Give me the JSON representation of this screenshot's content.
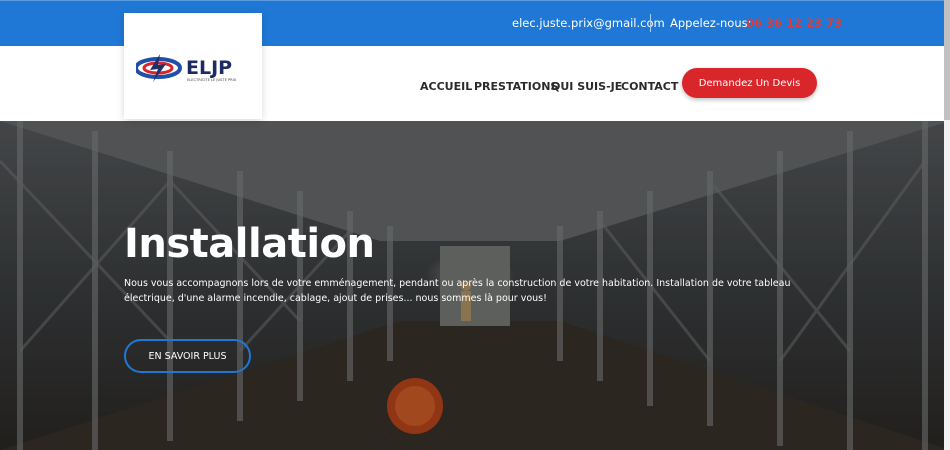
{
  "topbar": {
    "email": "elec.juste.prix@gmail.com",
    "call_label": "Appelez-nous:",
    "phone": "06 36 12 23 73"
  },
  "logo": {
    "text": "ELJP",
    "tagline": "ELECTRICITE LE JUSTE PRIX"
  },
  "nav": {
    "items": [
      "ACCUEIL",
      "PRESTATIONS",
      "QUI SUIS-JE",
      "CONTACT"
    ]
  },
  "cta": {
    "label": "Demandez Un Devis"
  },
  "hero": {
    "title": "Installation",
    "text": "Nous vous accompagnons lors de votre emménagement, pendant ou après la construction de votre habitation. Installation de votre tableau électrique, d'une alarme incendie, cablage, ajout de prises... nous sommes là pour vous!",
    "button": "EN SAVOIR PLUS"
  },
  "colors": {
    "topbar": "#1f78d6",
    "accent_red": "#d9262b",
    "phone_red": "#e53935"
  }
}
